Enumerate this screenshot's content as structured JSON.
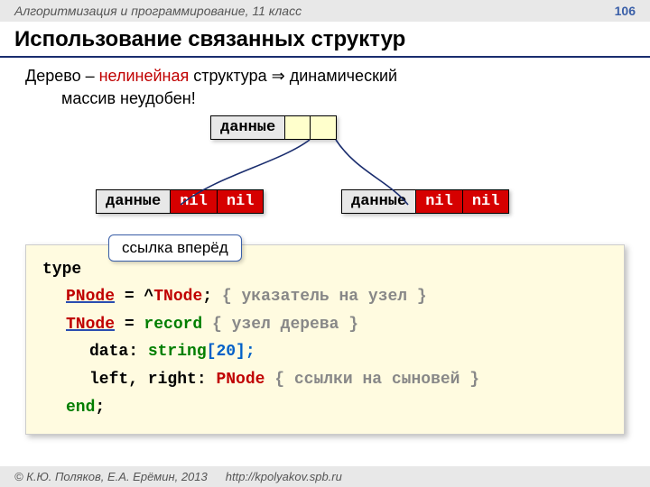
{
  "header": {
    "course": "Алгоритмизация и программирование, 11 класс",
    "page": "106"
  },
  "title": "Использование связанных структур",
  "intro": {
    "line1a": "Дерево – ",
    "nonlinear": "нелинейная",
    "line1b": " структура ",
    "arrow": "⇒",
    "line1c": " динамический",
    "line2": "массив неудобен!"
  },
  "nodes": {
    "data_label": "данные",
    "nil": "nil"
  },
  "callout": "ссылка вперёд",
  "code": {
    "l1": "type",
    "l2a": "PNode",
    "l2b": " = ^",
    "l2c": "TNode",
    "l2d": ";",
    "l2e": " { указатель на узел }",
    "l3a": "TNode",
    "l3b": " = ",
    "l3c": "record",
    "l3d": "  { узел дерева }",
    "l4a": "data: ",
    "l4b": "string",
    "l4c": "[",
    "l4d": "20",
    "l4e": "];",
    "l5a": "left, right: ",
    "l5b": "PNode",
    "l5c": " { ссылки на сыновей }",
    "l6": "end",
    "l6b": ";"
  },
  "footer": {
    "copyright": "© К.Ю. Поляков, Е.А. Ерёмин, 2013",
    "url": "http://kpolyakov.spb.ru"
  }
}
